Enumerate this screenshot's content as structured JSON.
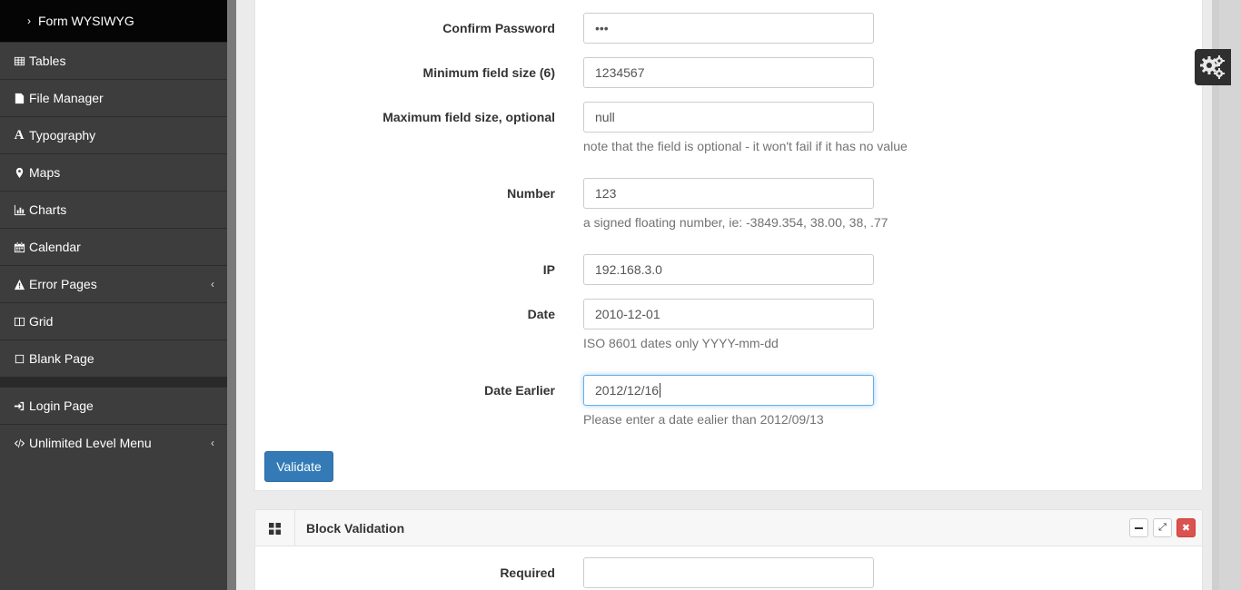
{
  "sidebar": {
    "top_sub": "Form WYSIWYG",
    "items": [
      {
        "label": "Tables",
        "icon": "table-icon"
      },
      {
        "label": "File Manager",
        "icon": "file-icon"
      },
      {
        "label": "Typography",
        "icon": "font-icon"
      },
      {
        "label": "Maps",
        "icon": "map-marker-icon"
      },
      {
        "label": "Charts",
        "icon": "bar-chart-icon"
      },
      {
        "label": "Calendar",
        "icon": "calendar-icon"
      },
      {
        "label": "Error Pages",
        "icon": "warning-icon"
      },
      {
        "label": "Grid",
        "icon": "columns-icon"
      },
      {
        "label": "Blank Page",
        "icon": "square-icon"
      },
      {
        "label": "Login Page",
        "icon": "sign-in-icon"
      },
      {
        "label": "Unlimited Level Menu",
        "icon": "code-icon"
      }
    ]
  },
  "form": {
    "confirm_password": {
      "label": "Confirm Password",
      "value": "•••"
    },
    "min_size": {
      "label": "Minimum field size (6)",
      "value": "1234567"
    },
    "max_size": {
      "label": "Maximum field size, optional",
      "value": "null",
      "help": "note that the field is optional - it won't fail if it has no value"
    },
    "number": {
      "label": "Number",
      "value": "123",
      "help": "a signed floating number, ie: -3849.354, 38.00, 38, .77"
    },
    "ip": {
      "label": "IP",
      "value": "192.168.3.0"
    },
    "date": {
      "label": "Date",
      "value": "2010-12-01",
      "help": "ISO 8601 dates only YYYY-mm-dd"
    },
    "date_earlier": {
      "label": "Date Earlier",
      "value": "2012/12/16",
      "help": "Please enter a date ealier than 2012/09/13"
    },
    "validate_label": "Validate"
  },
  "block_panel": {
    "title": "Block Validation",
    "required_label": "Required",
    "required_value": ""
  },
  "colors": {
    "primary": "#337ab7",
    "danger": "#d9534f",
    "sidebar_bg": "#3d3d3d"
  }
}
